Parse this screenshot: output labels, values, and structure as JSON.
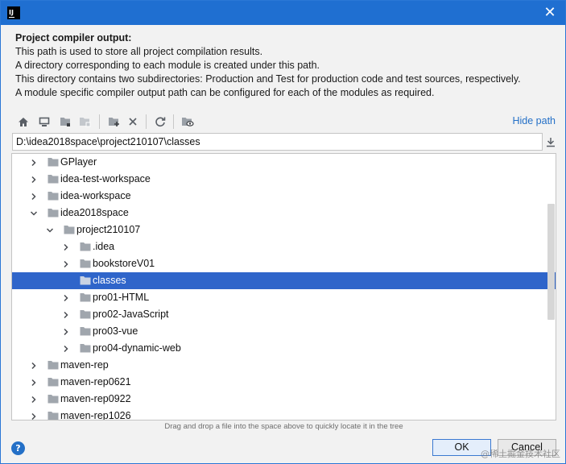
{
  "window": {
    "app_icon_text": "IJ",
    "close_glyph": "✕"
  },
  "description": {
    "title": "Project compiler output:",
    "lines": [
      "This path is used to store all project compilation results.",
      "A directory corresponding to each module is created under this path.",
      "This directory contains two subdirectories: Production and Test for production code and test sources, respectively.",
      "A module specific compiler output path can be configured for each of the modules as required."
    ]
  },
  "toolbar": {
    "icons": [
      "home-icon",
      "desktop-icon",
      "project-folder-icon",
      "module-folder-icon",
      "new-folder-icon",
      "delete-icon",
      "refresh-icon",
      "show-hidden-icon"
    ],
    "hide_path_label": "Hide path"
  },
  "path": {
    "value": "D:\\idea2018space\\project210107\\classes"
  },
  "tree": {
    "rows": [
      {
        "label": "GPlayer",
        "level": 0,
        "expanded": false,
        "selected": false
      },
      {
        "label": "idea-test-workspace",
        "level": 0,
        "expanded": false,
        "selected": false
      },
      {
        "label": "idea-workspace",
        "level": 0,
        "expanded": false,
        "selected": false
      },
      {
        "label": "idea2018space",
        "level": 0,
        "expanded": true,
        "selected": false
      },
      {
        "label": "project210107",
        "level": 1,
        "expanded": true,
        "selected": false
      },
      {
        "label": ".idea",
        "level": 2,
        "expanded": false,
        "selected": false
      },
      {
        "label": "bookstoreV01",
        "level": 2,
        "expanded": false,
        "selected": false
      },
      {
        "label": "classes",
        "level": 2,
        "expanded": null,
        "selected": true
      },
      {
        "label": "pro01-HTML",
        "level": 2,
        "expanded": false,
        "selected": false
      },
      {
        "label": "pro02-JavaScript",
        "level": 2,
        "expanded": false,
        "selected": false
      },
      {
        "label": "pro03-vue",
        "level": 2,
        "expanded": false,
        "selected": false
      },
      {
        "label": "pro04-dynamic-web",
        "level": 2,
        "expanded": false,
        "selected": false
      },
      {
        "label": "maven-rep",
        "level": 0,
        "expanded": false,
        "selected": false
      },
      {
        "label": "maven-rep0621",
        "level": 0,
        "expanded": false,
        "selected": false
      },
      {
        "label": "maven-rep0922",
        "level": 0,
        "expanded": false,
        "selected": false
      },
      {
        "label": "maven-rep1026",
        "level": 0,
        "expanded": false,
        "selected": false
      }
    ]
  },
  "hint": "Drag and drop a file into the space above to quickly locate it in the tree",
  "footer": {
    "help_glyph": "?",
    "ok_label": "OK",
    "cancel_label": "Cancel"
  },
  "watermark": "@稀土掘金技术社区",
  "colors": {
    "titlebar": "#1f6fd1",
    "selection": "#2f65ca",
    "link": "#2470c7",
    "folder": "#a0a6ad"
  }
}
